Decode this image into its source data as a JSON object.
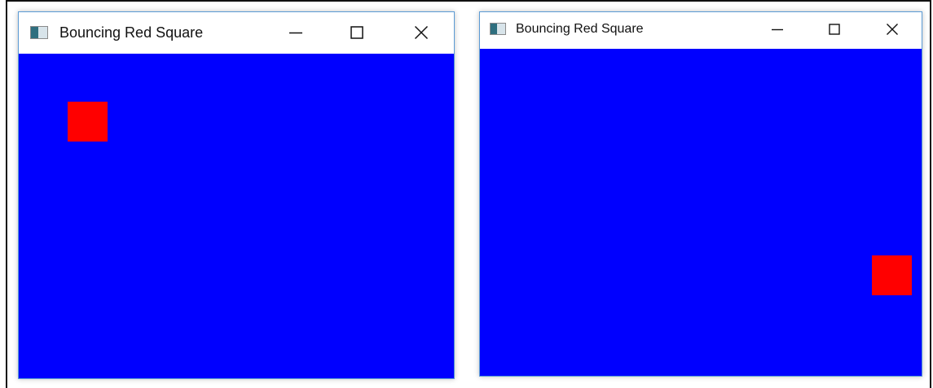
{
  "windows": [
    {
      "title": "Bouncing Red Square",
      "app_icon": "java-app-icon",
      "controls": {
        "minimize_icon": "minimize-icon",
        "maximize_icon": "maximize-icon",
        "close_icon": "close-icon"
      },
      "canvas_color": "#0000ff",
      "square_color": "#ff0000"
    },
    {
      "title": "Bouncing Red Square",
      "app_icon": "java-app-icon",
      "controls": {
        "minimize_icon": "minimize-icon",
        "maximize_icon": "maximize-icon",
        "close_icon": "close-icon"
      },
      "canvas_color": "#0000ff",
      "square_color": "#ff0000"
    }
  ]
}
